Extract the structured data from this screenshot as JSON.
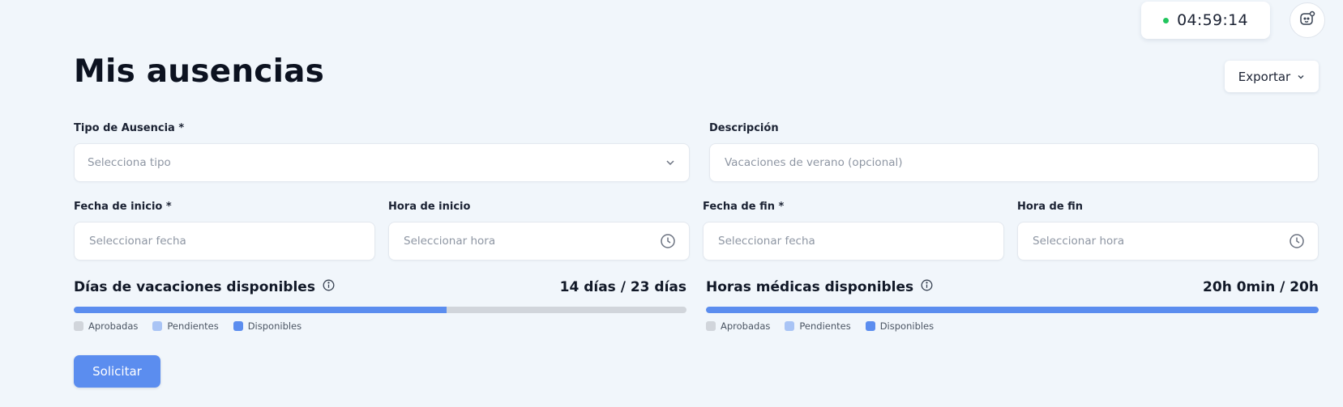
{
  "topbar": {
    "timer": "04:59:14",
    "timer_status_color": "#22c55e",
    "avatar_icon": "user-status-icon"
  },
  "page": {
    "title": "Mis ausencias",
    "export_label": "Exportar"
  },
  "form": {
    "absence_type": {
      "label": "Tipo de Ausencia *",
      "placeholder": "Selecciona tipo"
    },
    "description": {
      "label": "Descripción",
      "placeholder": "Vacaciones de verano (opcional)"
    },
    "start_date": {
      "label": "Fecha de inicio *",
      "placeholder": "Seleccionar fecha"
    },
    "start_time": {
      "label": "Hora de inicio",
      "placeholder": "Seleccionar hora"
    },
    "end_date": {
      "label": "Fecha de fin *",
      "placeholder": "Seleccionar fecha"
    },
    "end_time": {
      "label": "Hora de fin",
      "placeholder": "Seleccionar hora"
    },
    "submit_label": "Solicitar"
  },
  "vacation": {
    "title": "Días de vacaciones disponibles",
    "value": "14 días / 23 días",
    "fill_fraction": 0.6087,
    "legend": [
      "Aprobadas",
      "Pendientes",
      "Disponibles"
    ]
  },
  "medical": {
    "title": "Horas médicas disponibles",
    "value": "20h 0min / 20h",
    "fill_fraction": 1.0,
    "legend": [
      "Aprobadas",
      "Pendientes",
      "Disponibles"
    ]
  },
  "colors": {
    "accent": "#5b8def",
    "approved": "#d1d5db",
    "pending": "#a9c4f5",
    "available": "#5b8def"
  }
}
